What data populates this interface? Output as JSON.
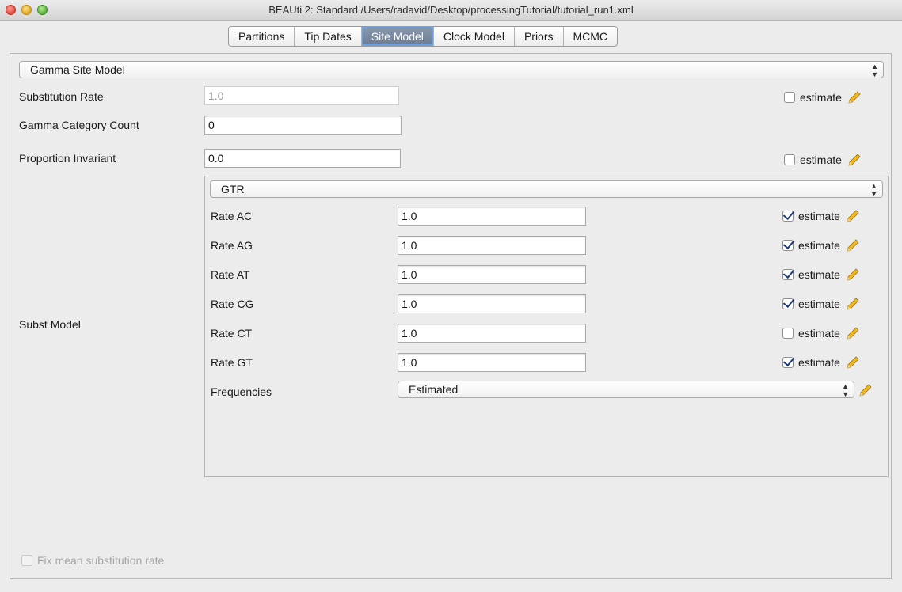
{
  "window": {
    "title": "BEAUti 2: Standard  /Users/radavid/Desktop/processingTutorial/tutorial_run1.xml"
  },
  "tabs": [
    "Partitions",
    "Tip Dates",
    "Site Model",
    "Clock Model",
    "Priors",
    "MCMC"
  ],
  "active_tab": "Site Model",
  "site_model": {
    "selector": "Gamma Site Model",
    "substitution_rate": {
      "label": "Substitution Rate",
      "value": "1.0",
      "estimate_label": "estimate",
      "estimate_checked": false
    },
    "gamma_category_count": {
      "label": "Gamma Category Count",
      "value": "0"
    },
    "proportion_invariant": {
      "label": "Proportion Invariant",
      "value": "0.0",
      "estimate_label": "estimate",
      "estimate_checked": false
    },
    "subst_model_label": "Subst Model"
  },
  "subst_model": {
    "selector": "GTR",
    "rates": [
      {
        "label": "Rate AC",
        "value": "1.0",
        "estimate_label": "estimate",
        "checked": true
      },
      {
        "label": "Rate AG",
        "value": "1.0",
        "estimate_label": "estimate",
        "checked": true
      },
      {
        "label": "Rate AT",
        "value": "1.0",
        "estimate_label": "estimate",
        "checked": true
      },
      {
        "label": "Rate CG",
        "value": "1.0",
        "estimate_label": "estimate",
        "checked": true
      },
      {
        "label": "Rate CT",
        "value": "1.0",
        "estimate_label": "estimate",
        "checked": false
      },
      {
        "label": "Rate GT",
        "value": "1.0",
        "estimate_label": "estimate",
        "checked": true
      }
    ],
    "frequencies": {
      "label": "Frequencies",
      "value": "Estimated"
    }
  },
  "fix_mean": {
    "label": "Fix mean substitution rate",
    "checked": false,
    "enabled": false
  },
  "icons": {
    "pencil": "pencil-icon",
    "checkbox": "checkbox",
    "combo_arrows": "updown-arrows-icon"
  },
  "colors": {
    "active_tab": "#6b7b93",
    "checkmark": "#1e3a78",
    "pencil": "#f0b81c"
  }
}
